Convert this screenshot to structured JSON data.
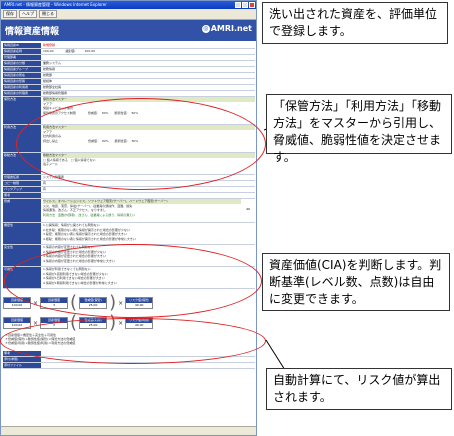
{
  "window": {
    "title": "AMRI.net - 情報資産管理 - Windows Internet Explorer"
  },
  "toolbar": {
    "save": "保存",
    "help": "ヘルプ",
    "close": "閉じる"
  },
  "app": {
    "title": "情報資産情報",
    "logo": "AMRI.net"
  },
  "form": {
    "rows": [
      {
        "label": "情報資産ID",
        "value": "新規登録",
        "red": true
      },
      {
        "label": "情報資産名称",
        "value": "100.00　　　　識別値:　　　100.00"
      },
      {
        "label": "管理部署",
        "value": ""
      },
      {
        "label": "情報資産の分類",
        "value": "業務システム"
      },
      {
        "label": "情報資産グループ",
        "value": "総務情報"
      },
      {
        "label": "情報資産の所在",
        "value": "総務部"
      },
      {
        "label": "情報資産の形態",
        "value": "紙媒体"
      },
      {
        "label": "情報資産の利用者",
        "value": "総務部全社員"
      },
      {
        "label": "情報資産の管理者",
        "value": "総務部情報管理者"
      }
    ],
    "storage": {
      "label": "保管方法",
      "lines": [
        "保管方法マスター",
        "マアア",
        "施錠キャビネット保管",
        "保管場所のアクセス制限　　　　脅威値:　 80%　　脆弱性値:　 80%"
      ]
    },
    "usage": {
      "label": "利用方法",
      "lines": [
        "利用方法マスター",
        "マアア",
        "社内利用のみ",
        "持出し禁止　　　　　　　　　　脅威値:　 80%　　脆弱性値:　 80%"
      ]
    },
    "transfer": {
      "label": "移動方法",
      "lines": [
        "移動方法マスター",
        "□ 個人情報である　□ 個人情報でない",
        "電子メール"
      ]
    },
    "misc_rows": [
      {
        "label": "管理責任者",
        "value": "システム管理者"
      },
      {
        "label": "コピー制限",
        "value": "有"
      },
      {
        "label": "バックアップ",
        "value": "有"
      },
      {
        "label": "備考",
        "value": ""
      }
    ],
    "threat": {
      "label": "脅威",
      "lines": [
        "ウイルス、オペレーションミス、ソフトウェア障害(サーバー)、ハードウェア障害(サーバー)",
        "火災、地震、落雷、停電(サーバー)、従業員の誤操作、盗難、紛失",
        "情報漏洩、改ざん、不正アクセス、なりすまし",
        "利用方法　盗難(外部者)、改ざん、従業員による誤り、情報の漏えい"
      ],
      "ratio": "40"
    },
    "confidentiality": {
      "label": "機密性",
      "lines": [
        "1.公開情報：情報が公開されても問題ない",
        "2.社外秘：権限のない者に情報が開示された場合の影響が少ない",
        "3.秘密：権限のない者に情報が開示された場合の影響が大きい",
        "4.極秘：権限のない者に情報が開示された場合の影響が非常に大きい"
      ]
    },
    "integrity": {
      "label": "完全性",
      "lines": [
        "1.情報の内容が変更されても問題ない",
        "2.情報の内容が変更された場合の影響が少ない",
        "3.情報の内容が変更された場合の影響が大きい",
        "4.情報の内容が変更された場合の影響が非常に大きい"
      ]
    },
    "availability": {
      "label": "可用性",
      "lines": [
        "1.情報が利用できなくても問題ない",
        "2.情報が1週間利用できない場合の影響が少ない",
        "3.情報が1日利用できない場合の影響が大きい",
        "4.情報が1時間利用できない場合の影響が非常に大きい"
      ]
    },
    "calc1": [
      {
        "head": "資産価値",
        "value": "100.00"
      },
      {
        "head": "資産価値",
        "value": "3"
      },
      {
        "head": "脅威値(保管)",
        "value": "25.00"
      },
      {
        "head": "リスク値(保管)",
        "value": "40.00"
      }
    ],
    "calc2": [
      {
        "head": "資産価値",
        "value": "100.00"
      },
      {
        "head": "資産価値",
        "value": "2"
      },
      {
        "head": "脅威値(利用)",
        "value": "25.00"
      },
      {
        "head": "リスク値(利用)",
        "value": "40.00"
      }
    ],
    "notes": [
      "＊資産価値＝機密性＋完全性＋可用性",
      "＊脅威値(保管)×脆弱性値(保管)＝保管方法の脅威値",
      "＊脅威値(利用)×脆弱性値(利用)＝利用方法の脅威値"
    ],
    "bottom_rows": [
      {
        "label": "備考",
        "value": ""
      },
      {
        "label": "添付(参照)",
        "value": ""
      },
      {
        "label": "添付ファイル",
        "value": ""
      }
    ]
  },
  "callouts": {
    "c1": "洗い出された資産を、評価単位で登録します。",
    "c2": "「保管方法」「利用方法」「移動方法」をマスターから引用し、脅威値、脆弱性値を決定させます。",
    "c3": "資産価値(CIA)を判断します。判断基準(レベル数、点数)は自由に変更できます。",
    "c4": "自動計算にて、リスク値が算出されます。"
  }
}
